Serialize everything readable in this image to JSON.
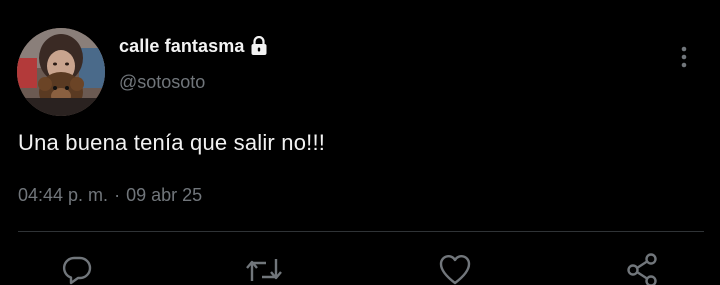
{
  "user": {
    "display_name": "calle fantasma",
    "handle": "@sotosoto",
    "protected_icon": "lock-icon",
    "avatar_icon": "profile-photo"
  },
  "tweet": {
    "text": "Una buena tenía que salir no!!!",
    "time": "04:44 p. m.",
    "separator": "·",
    "date": "09 abr 25"
  },
  "actions": [
    {
      "icon": "reply-icon"
    },
    {
      "icon": "retweet-icon"
    },
    {
      "icon": "like-icon"
    },
    {
      "icon": "share-icon"
    }
  ],
  "menu": {
    "icon": "more-options-icon"
  },
  "colors": {
    "background": "#000000",
    "primary_text": "#f2f2f2",
    "secondary_text": "#71767b",
    "divider": "#2f3336"
  }
}
